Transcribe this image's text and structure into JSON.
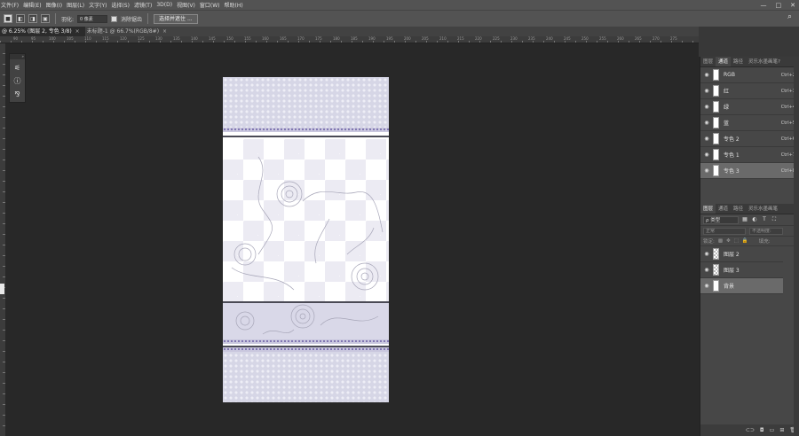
{
  "menu": [
    "文件(F)",
    "编辑(E)",
    "图像(I)",
    "图层(L)",
    "文字(Y)",
    "选择(S)",
    "滤镜(T)",
    "3D(D)",
    "视图(V)",
    "窗口(W)",
    "帮助(H)"
  ],
  "window_controls": [
    "—",
    "□",
    "✕"
  ],
  "options": {
    "feather_label": "羽化:",
    "feather_value": "0 像素",
    "antialias_label": "消除锯齿",
    "select_mask_button": "选择并遮住 ..."
  },
  "tabs": [
    {
      "label": "@ 6.25% (图层 2, 专色 3/8)",
      "close": "×"
    },
    {
      "label": "未标题-1 @ 66.7%(RGB/8#)",
      "close": "×"
    }
  ],
  "ruler_labels": [
    "90",
    "95",
    "100",
    "105",
    "110",
    "115",
    "120",
    "125",
    "130",
    "135",
    "140",
    "145",
    "150",
    "155",
    "160",
    "165",
    "170",
    "175",
    "180",
    "185",
    "190",
    "195",
    "200",
    "205",
    "210",
    "215",
    "220",
    "225",
    "230",
    "235",
    "240",
    "245",
    "250",
    "255",
    "260",
    "265",
    "270",
    "275"
  ],
  "channels_panel": {
    "tabs": [
      "图层",
      "通道",
      "路径",
      "灵乐水墨画笔?"
    ],
    "active_tab": 1,
    "rows": [
      {
        "name": "RGB",
        "key": "Ctrl+2",
        "selected": false
      },
      {
        "name": "红",
        "key": "Ctrl+3",
        "selected": false
      },
      {
        "name": "绿",
        "key": "Ctrl+4",
        "selected": false
      },
      {
        "name": "蓝",
        "key": "Ctrl+5",
        "selected": false
      },
      {
        "name": "专色 2",
        "key": "Ctrl+6",
        "selected": false
      },
      {
        "name": "专色 1",
        "key": "Ctrl+7",
        "selected": false
      },
      {
        "name": "专色 3",
        "key": "Ctrl+8",
        "selected": true
      }
    ]
  },
  "layers_panel": {
    "tabs": [
      "图层",
      "通道",
      "路径",
      "灵乐水墨画笔"
    ],
    "active_tab": 0,
    "filter_label": "ρ 类型",
    "blend_mode": "正常",
    "opacity_label": "不透明度:",
    "lock_label": "锁定:",
    "fill_label": "填充:",
    "rows": [
      {
        "name": "图层 2",
        "selected": false
      },
      {
        "name": "图层 3",
        "selected": false
      },
      {
        "name": "背景",
        "selected": true
      }
    ]
  },
  "colors": {
    "lace": "#d6d6e6",
    "lace_trim": "#7b6fae",
    "checker": "#ecebf3",
    "band": "#d9d8e8",
    "rose_stroke": "#a7a6b8"
  }
}
